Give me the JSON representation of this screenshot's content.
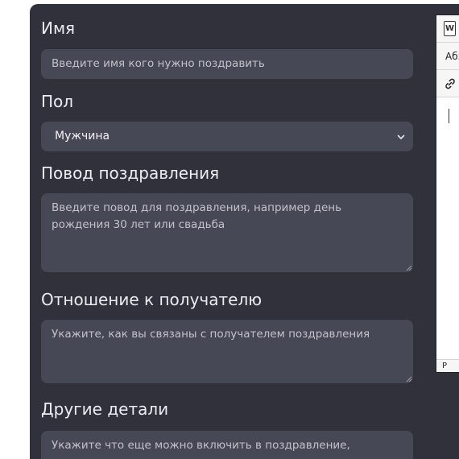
{
  "form": {
    "name": {
      "label": "Имя",
      "placeholder": "Введите имя кого нужно поздравить"
    },
    "gender": {
      "label": "Пол",
      "selected": "Мужчина"
    },
    "occasion": {
      "label": "Повод поздравления",
      "placeholder": "Введите повод для поздравления, например день рождения 30 лет или свадьба"
    },
    "relation": {
      "label": "Отношение к получателю",
      "placeholder": "Укажите, как вы связаны с получателем поздравления"
    },
    "details": {
      "label": "Другие детали",
      "placeholder": "Укажите что еще можно включить в поздравление, например"
    }
  },
  "editor": {
    "word_icon_letter": "W",
    "format_label": "Абз",
    "status_path": "P"
  },
  "colors": {
    "panel": "#31313b",
    "field": "#474856",
    "label_text": "#ececf2",
    "placeholder_text": "#c2c2cb"
  }
}
